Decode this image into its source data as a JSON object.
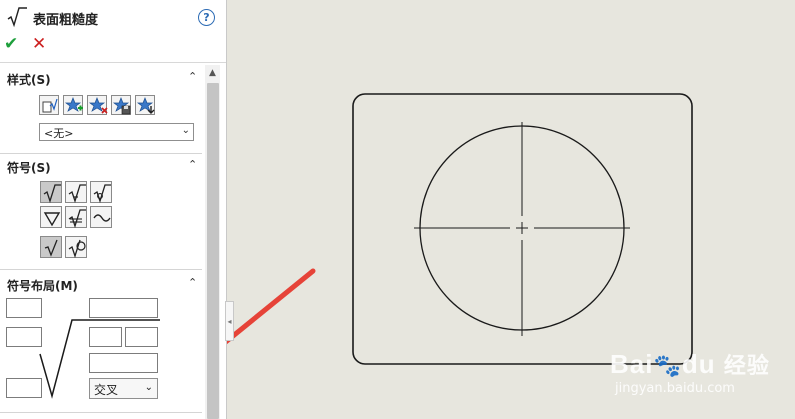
{
  "panel": {
    "title": "表面粗糙度",
    "help_label": "?",
    "ok_label": "✔",
    "cancel_label": "✕",
    "scroll_up": "▲",
    "sections": {
      "style": {
        "title": "样式(S)",
        "collapse": "⌃",
        "select_value": "<无>",
        "select_arrow": "⌄"
      },
      "symbol": {
        "title": "符号(S)",
        "collapse": "⌃"
      },
      "layout": {
        "title": "符号布局(M)",
        "collapse": "⌃",
        "direction_value": "交叉",
        "direction_arrow": "⌄"
      }
    },
    "style_buttons": [
      "update-style-icon",
      "add-style-icon",
      "delete-style-icon",
      "save-style-icon",
      "load-style-icon"
    ],
    "symbol_buttons": [
      "basic-icon",
      "machining-required-icon",
      "machining-prohibited-icon",
      "jis-basic-icon",
      "jis-machining-icon",
      "jis-no-machining-icon",
      "local-icon",
      "all-around-icon"
    ],
    "colors": {
      "ok": "#1e9f3c",
      "cancel": "#cc1f1f",
      "help": "#2d6cb5",
      "arrow": "#e64338"
    }
  },
  "watermark": {
    "brand": "Bai",
    "brand_paw": "du",
    "brand_suffix": "经验",
    "url": "jingyan.baidu.com"
  }
}
